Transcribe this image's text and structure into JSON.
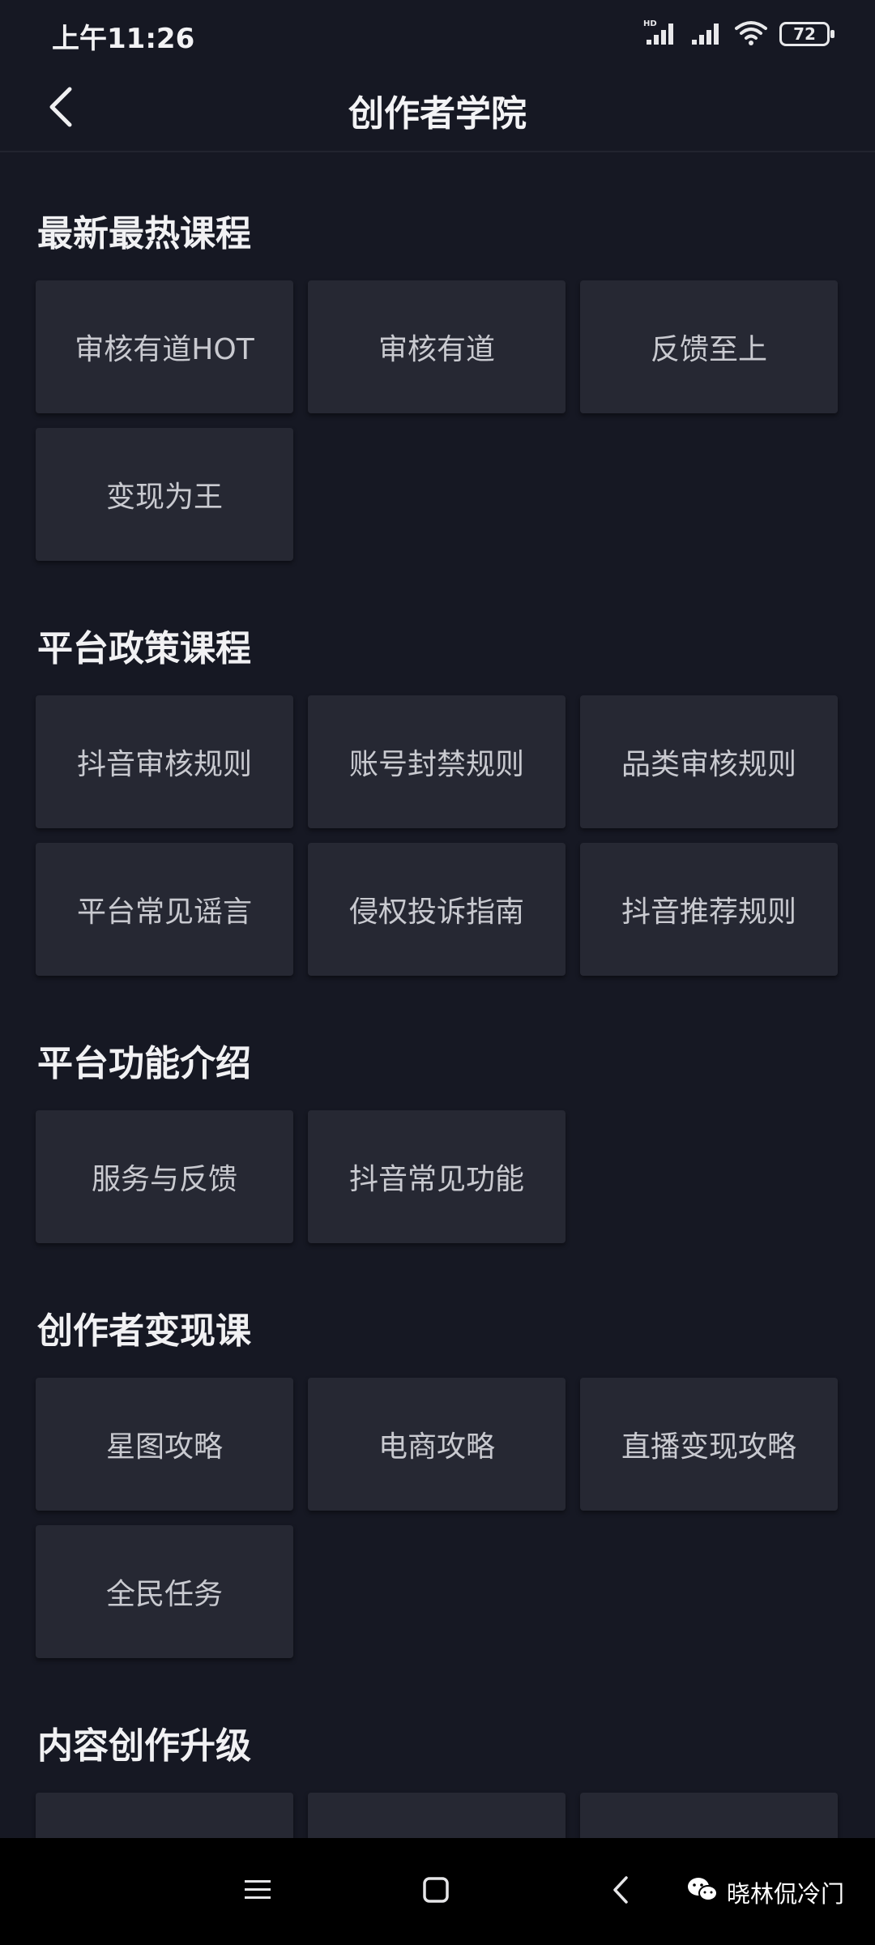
{
  "status_bar": {
    "time": "上午11:26",
    "battery": "72"
  },
  "header": {
    "title": "创作者学院"
  },
  "sections": [
    {
      "title": "最新最热课程",
      "items": [
        "审核有道HOT",
        "审核有道",
        "反馈至上",
        "变现为王"
      ]
    },
    {
      "title": "平台政策课程",
      "items": [
        "抖音审核规则",
        "账号封禁规则",
        "品类审核规则",
        "平台常见谣言",
        "侵权投诉指南",
        "抖音推荐规则"
      ]
    },
    {
      "title": "平台功能介绍",
      "items": [
        "服务与反馈",
        "抖音常见功能"
      ]
    },
    {
      "title": "创作者变现课",
      "items": [
        "星图攻略",
        "电商攻略",
        "直播变现攻略",
        "全民任务"
      ]
    },
    {
      "title": "内容创作升级",
      "items": [
        "",
        "",
        ""
      ]
    }
  ],
  "watermark": {
    "text": "晓林侃冷门"
  },
  "icons": {
    "back": "chevron-left-icon",
    "signal": "signal-icon",
    "wifi": "wifi-icon",
    "menu": "menu-icon",
    "home": "home-icon",
    "nav_back": "back-icon",
    "wechat": "wechat-icon"
  }
}
